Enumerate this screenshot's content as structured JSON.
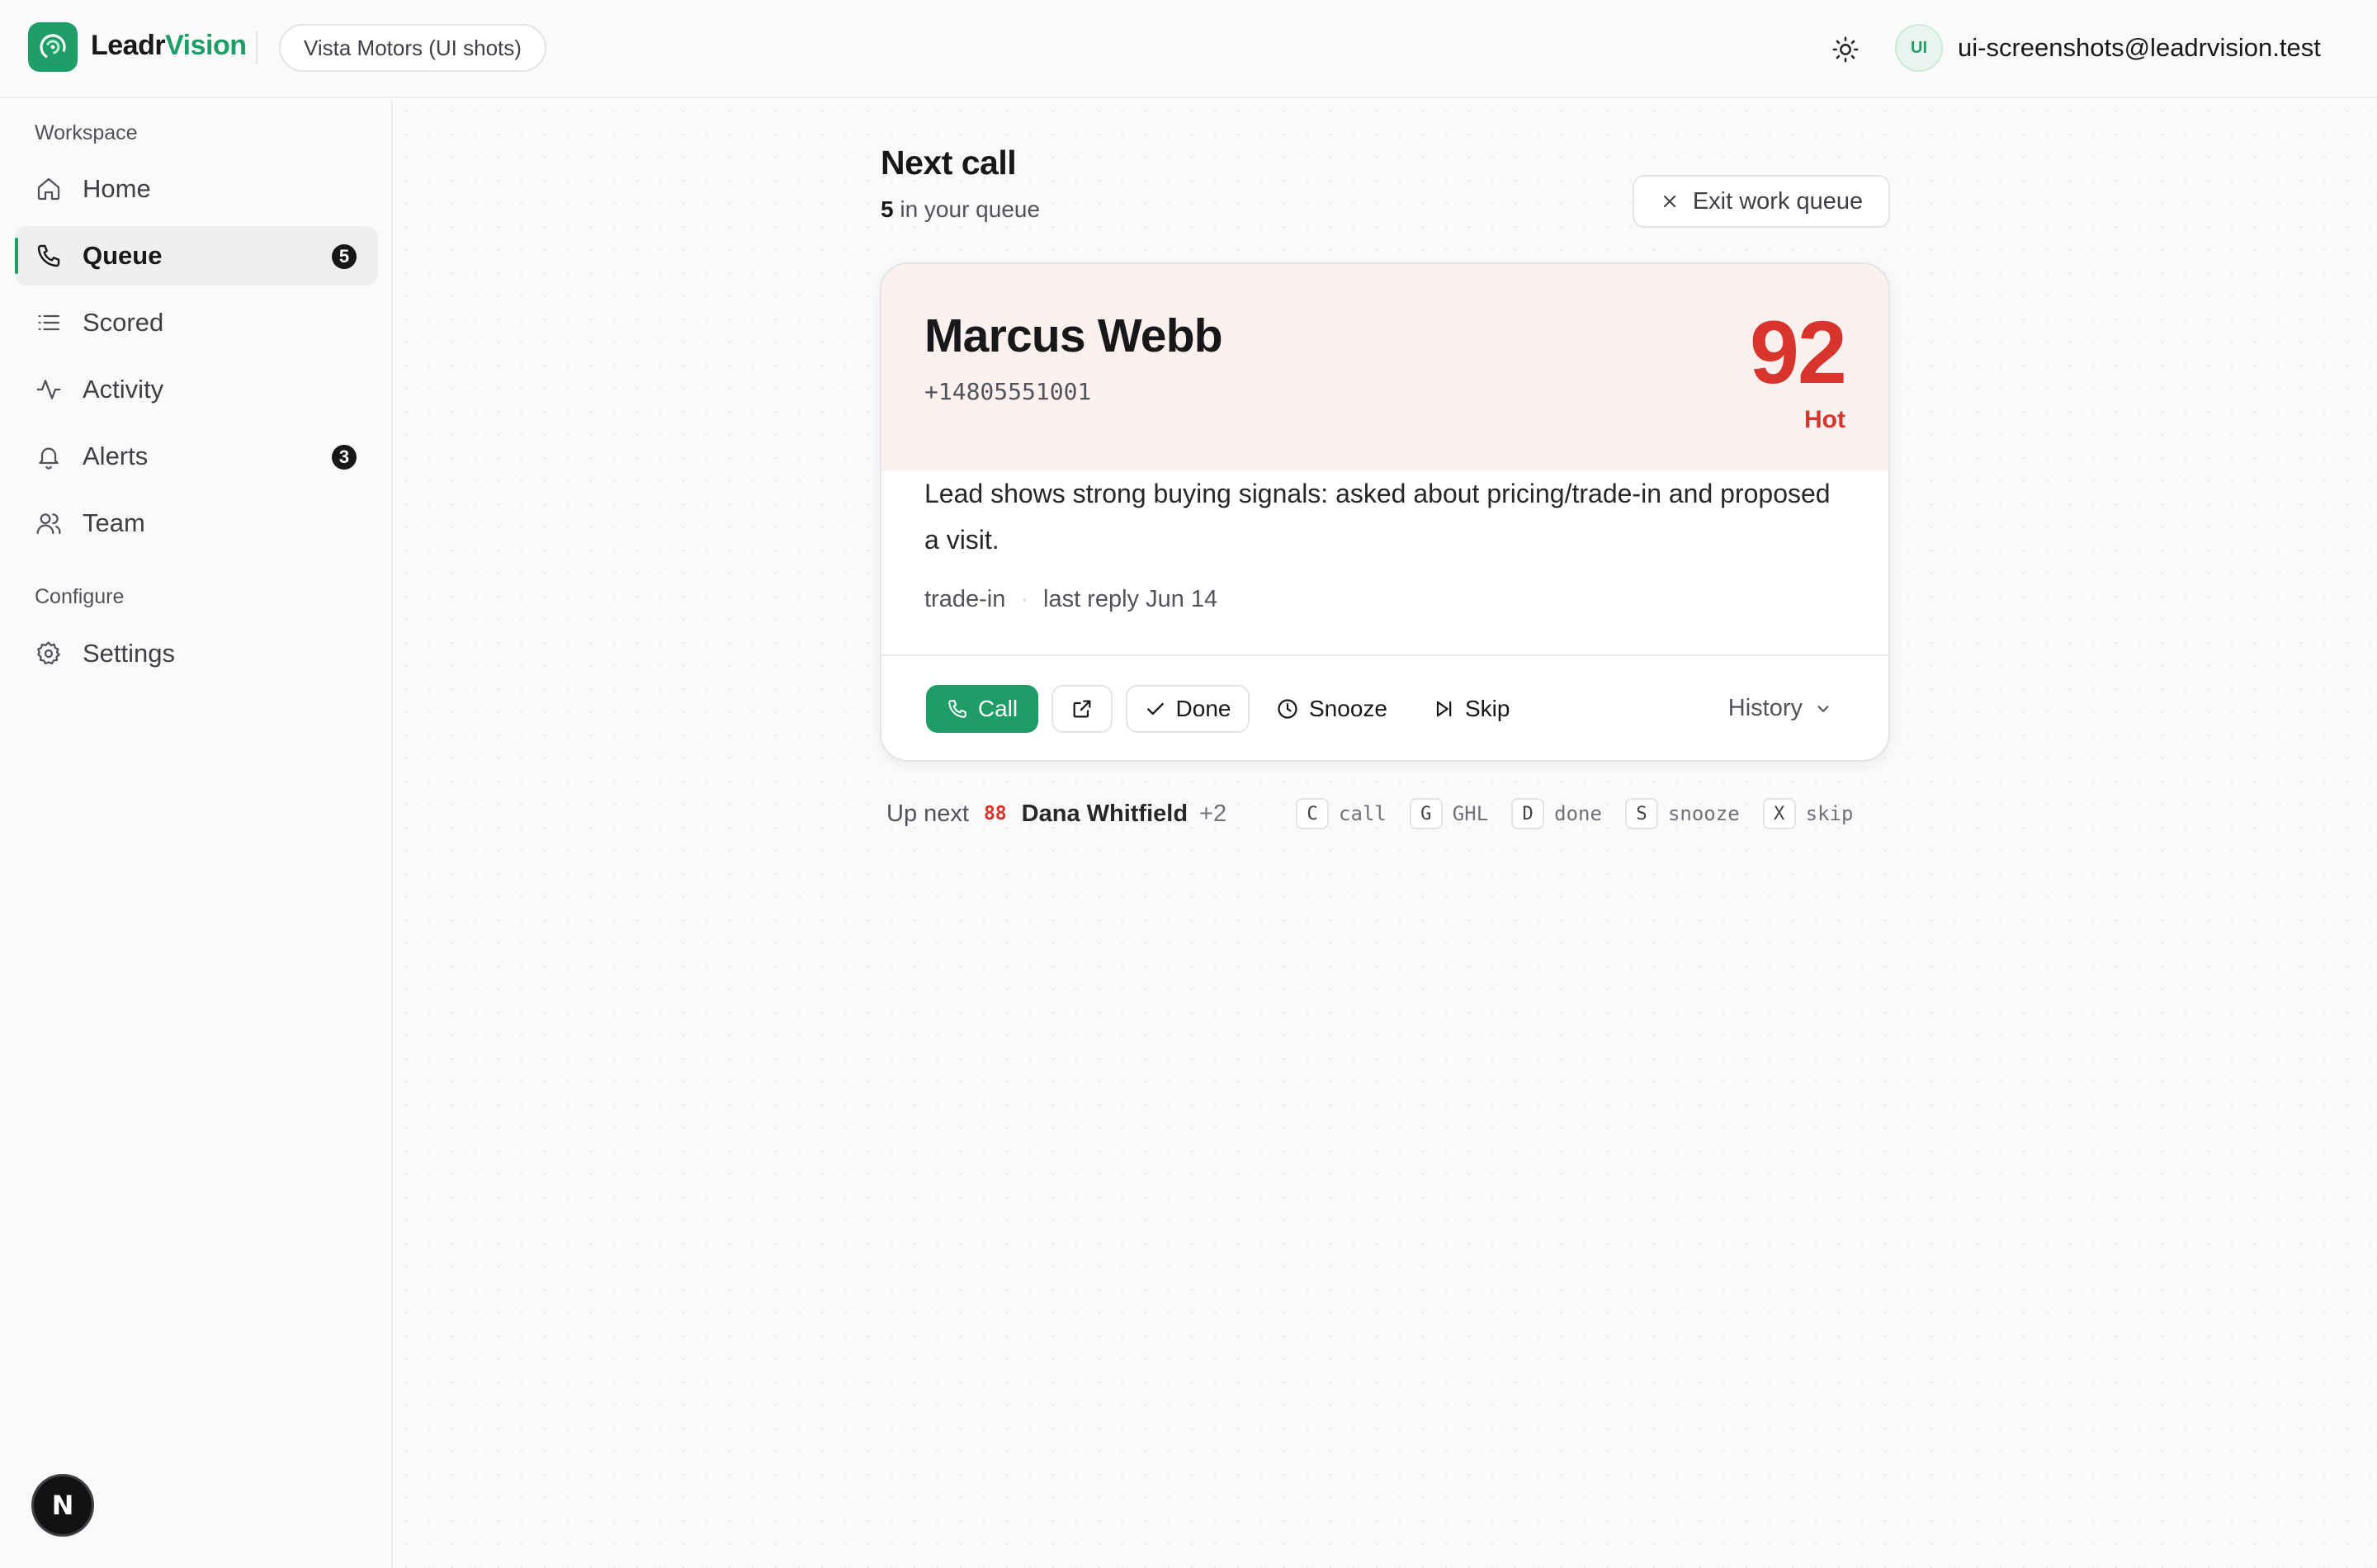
{
  "header": {
    "brand_prefix": "Leadr",
    "brand_suffix": "Vision",
    "org": "Vista Motors (UI shots)",
    "avatar_initials": "UI",
    "user_email": "ui-screenshots@leadrvision.test"
  },
  "sidebar": {
    "workspace_label": "Workspace",
    "configure_label": "Configure",
    "items": [
      {
        "label": "Home",
        "icon": "home-icon"
      },
      {
        "label": "Queue",
        "icon": "phone-icon",
        "badge": "5",
        "active": true
      },
      {
        "label": "Scored",
        "icon": "list-icon"
      },
      {
        "label": "Activity",
        "icon": "activity-icon"
      },
      {
        "label": "Alerts",
        "icon": "bell-icon",
        "badge": "3"
      },
      {
        "label": "Team",
        "icon": "users-icon"
      }
    ],
    "settings": {
      "label": "Settings",
      "icon": "gear-icon"
    },
    "dev_badge": "N"
  },
  "main": {
    "title": "Next call",
    "queue_count": "5",
    "queue_suffix": " in your queue",
    "exit_label": "Exit work queue",
    "lead": {
      "name": "Marcus Webb",
      "phone": "+14805551001",
      "score": "92",
      "score_label": "Hot",
      "summary": "Lead shows strong buying signals: asked about pricing/trade-in and proposed a visit.",
      "tag": "trade-in",
      "last_reply": "last reply Jun 14"
    },
    "actions": {
      "call": "Call",
      "done": "Done",
      "snooze": "Snooze",
      "skip": "Skip",
      "history": "History"
    },
    "up_next": {
      "label": "Up next",
      "score": "88",
      "name": "Dana Whitfield",
      "more": "+2"
    },
    "shortcuts": [
      {
        "key": "C",
        "label": "call"
      },
      {
        "key": "G",
        "label": "GHL"
      },
      {
        "key": "D",
        "label": "done"
      },
      {
        "key": "S",
        "label": "snooze"
      },
      {
        "key": "X",
        "label": "skip"
      }
    ]
  },
  "colors": {
    "brand": "#1f9d66",
    "hot": "#d9342b",
    "card_top": "#fdf1f0"
  }
}
